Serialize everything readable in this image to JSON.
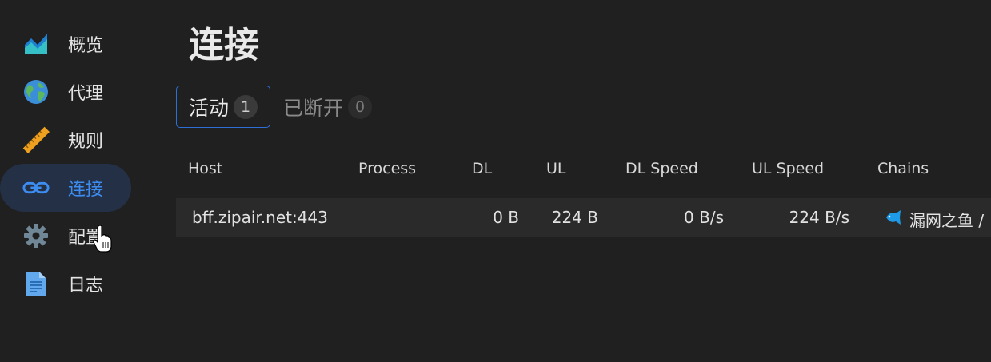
{
  "sidebar": {
    "items": [
      {
        "label": "概览",
        "icon": "chart-area-icon"
      },
      {
        "label": "代理",
        "icon": "globe-icon"
      },
      {
        "label": "规则",
        "icon": "ruler-icon"
      },
      {
        "label": "连接",
        "icon": "link-icon",
        "active": true
      },
      {
        "label": "配置",
        "icon": "gear-icon"
      },
      {
        "label": "日志",
        "icon": "document-icon"
      }
    ]
  },
  "page": {
    "title": "连接"
  },
  "tabs": [
    {
      "label": "活动",
      "count": "1",
      "active": true
    },
    {
      "label": "已断开",
      "count": "0",
      "active": false
    }
  ],
  "table": {
    "columns": [
      "Host",
      "Process",
      "DL",
      "UL",
      "DL Speed",
      "UL Speed",
      "Chains"
    ],
    "rows": [
      {
        "host": "bff.zipair.net:443",
        "process": "",
        "dl": "0 B",
        "ul": "224 B",
        "dl_speed": "0 B/s",
        "ul_speed": "224 B/s",
        "chains": "漏网之鱼 /"
      }
    ]
  },
  "colors": {
    "background": "#202020",
    "active_nav_bg": "#233046",
    "accent": "#3d8cf0",
    "tab_border": "#2e6fd6",
    "row_bg": "#2a2a2a"
  }
}
